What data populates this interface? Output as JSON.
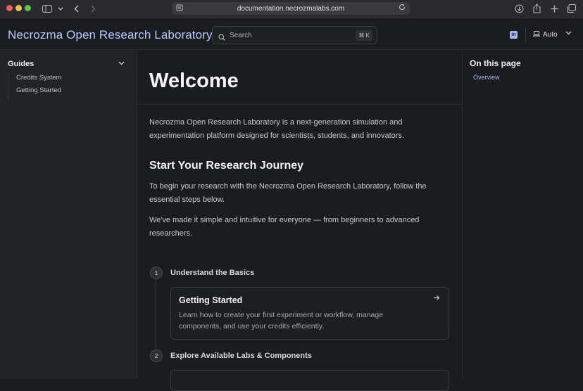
{
  "browser": {
    "url": "documentation.necrozmalabs.com",
    "icons": [
      "sidebar-toggle-icon",
      "chevron-down-icon",
      "back-icon",
      "forward-icon",
      "reader-icon",
      "reload-icon",
      "download-icon",
      "share-icon",
      "new-tab-icon",
      "tabs-overview-icon"
    ]
  },
  "header": {
    "brand": "Necrozma Open Research Laboratory",
    "search_placeholder": "Search",
    "search_shortcut": "⌘ K",
    "theme_label": "Auto"
  },
  "sidebar": {
    "section_title": "Guides",
    "items": [
      {
        "label": "Credits System"
      },
      {
        "label": "Getting Started"
      }
    ]
  },
  "main": {
    "title": "Welcome",
    "intro": "Necrozma Open Research Laboratory is a next-generation simulation and experimentation platform designed for scientists, students, and innovators.",
    "section_heading": "Start Your Research Journey",
    "para1": "To begin your research with the Necrozma Open Research Laboratory, follow the essential steps below.",
    "para2": "We've made it simple and intuitive for everyone — from beginners to advanced researchers.",
    "steps": [
      {
        "number": "1",
        "title": "Understand the Basics",
        "card_title": "Getting Started",
        "card_desc": "Learn how to create your first experiment or workflow, manage components, and use your credits efficiently."
      },
      {
        "number": "2",
        "title": "Explore Available Labs & Components"
      }
    ]
  },
  "toc": {
    "title": "On this page",
    "items": [
      {
        "label": "Overview"
      }
    ]
  },
  "colors": {
    "accent": "#b8c7ff",
    "background": "#1b1c1f",
    "sidebar_bg": "#222327"
  }
}
